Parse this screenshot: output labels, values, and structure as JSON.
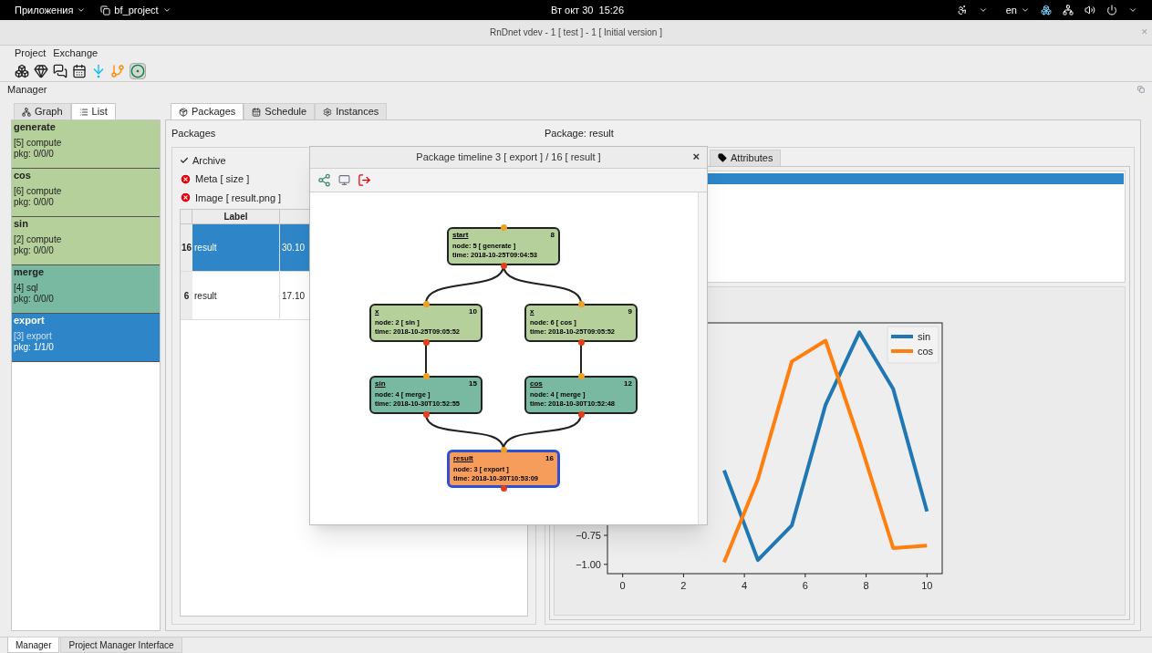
{
  "system_bar": {
    "apps_menu": "Приложения",
    "app_name": "bf_project",
    "clock": "Вт окт 30  15:26",
    "language": "en"
  },
  "window": {
    "title": "RnDnet vdev - 1 [ test ] - 1 [ Initial version ]",
    "close": "✕"
  },
  "menu": [
    "Project",
    "Exchange"
  ],
  "manager_label": "Manager",
  "left_tabs": [
    {
      "label": "Graph",
      "selected": false
    },
    {
      "label": "List",
      "selected": true
    }
  ],
  "nodes_list": [
    {
      "name": "generate",
      "type": "[5] compute",
      "pkg": "pkg: 0/0/0",
      "color": "#b5d09b",
      "selected": false
    },
    {
      "name": "cos",
      "type": "[6] compute",
      "pkg": "pkg: 0/0/0",
      "color": "#b5d09b",
      "selected": false
    },
    {
      "name": "sin",
      "type": "[2] compute",
      "pkg": "pkg: 0/0/0",
      "color": "#b5d09b",
      "selected": false
    },
    {
      "name": "merge",
      "type": "[4] sql",
      "pkg": "pkg: 0/0/0",
      "color": "#79b9a1",
      "selected": false
    },
    {
      "name": "export",
      "type": "[3] export",
      "pkg": "pkg: 1/1/0",
      "color": "#2e86c8",
      "selected": true
    }
  ],
  "center_tabs": [
    {
      "label": "Packages",
      "selected": true
    },
    {
      "label": "Schedule",
      "selected": false
    },
    {
      "label": "Instances",
      "selected": false
    }
  ],
  "packages": {
    "title": "Packages",
    "archive": {
      "label": "Archive",
      "checked": true
    },
    "filters": [
      "Meta [ size ]",
      "Image [ result.png ]"
    ],
    "table": {
      "columns": [
        "Label"
      ],
      "rows": [
        {
          "number": "16",
          "cells": [
            "result",
            "30.10"
          ],
          "selected": true
        },
        {
          "number": "6",
          "cells": [
            "result",
            "17.10"
          ],
          "selected": false
        }
      ]
    }
  },
  "package_detail": {
    "title": "Package: result",
    "tabs": [
      {
        "label": "Attributes",
        "selected": false
      }
    ],
    "chart_data": {
      "type": "line",
      "x": [
        3.333,
        4.444,
        5.556,
        6.667,
        7.778,
        8.889,
        10
      ],
      "series": [
        {
          "name": "sin",
          "color": "#1f77b4",
          "values": [
            -0.191,
            -0.963,
            -0.665,
            0.375,
            0.998,
            0.51,
            -0.544
          ]
        },
        {
          "name": "cos",
          "color": "#ff7f0e",
          "values": [
            -0.982,
            -0.268,
            0.747,
            0.927,
            0.066,
            -0.86,
            -0.839
          ]
        }
      ],
      "legend": true,
      "xlim": [
        -0.5,
        10.5
      ],
      "ylim": [
        -1.08,
        1.08
      ],
      "xticks": [
        0,
        2,
        4,
        6,
        8,
        10
      ],
      "yticks": [
        {
          "value": -1,
          "label": "−1.00"
        },
        {
          "value": -0.75,
          "label": "−0.75"
        }
      ]
    }
  },
  "timeline_dialog": {
    "title": "Package timeline 3 [ export ] / 16 [ result ]",
    "close": "×",
    "nodes": [
      {
        "title": "start",
        "number": "8",
        "node": "node: 5 [ generate ]",
        "time": "time: 2018-10-25T09:04:53",
        "color": "#b5d09b",
        "selected": false
      },
      {
        "title": "x",
        "number": "10",
        "node": "node: 2 [ sin ]",
        "time": "time: 2018-10-25T09:05:52",
        "color": "#b5d09b",
        "selected": false
      },
      {
        "title": "x",
        "number": "9",
        "node": "node: 6 [ cos ]",
        "time": "time: 2018-10-25T09:05:52",
        "color": "#b5d09b",
        "selected": false
      },
      {
        "title": "sin",
        "number": "15",
        "node": "node: 4 [ merge ]",
        "time": "time: 2018-10-30T10:52:55",
        "color": "#79b9a1",
        "selected": false
      },
      {
        "title": "cos",
        "number": "12",
        "node": "node: 4 [ merge ]",
        "time": "time: 2018-10-30T10:52:48",
        "color": "#79b9a1",
        "selected": false
      },
      {
        "title": "result",
        "number": "16",
        "node": "node: 3 [ export ]",
        "time": "time: 2018-10-30T10:53:09",
        "color": "#f79d5c",
        "selected": true
      }
    ]
  },
  "bottom_tabs": [
    {
      "label": "Manager",
      "selected": true
    },
    {
      "label": "Project Manager Interface",
      "selected": false
    }
  ]
}
